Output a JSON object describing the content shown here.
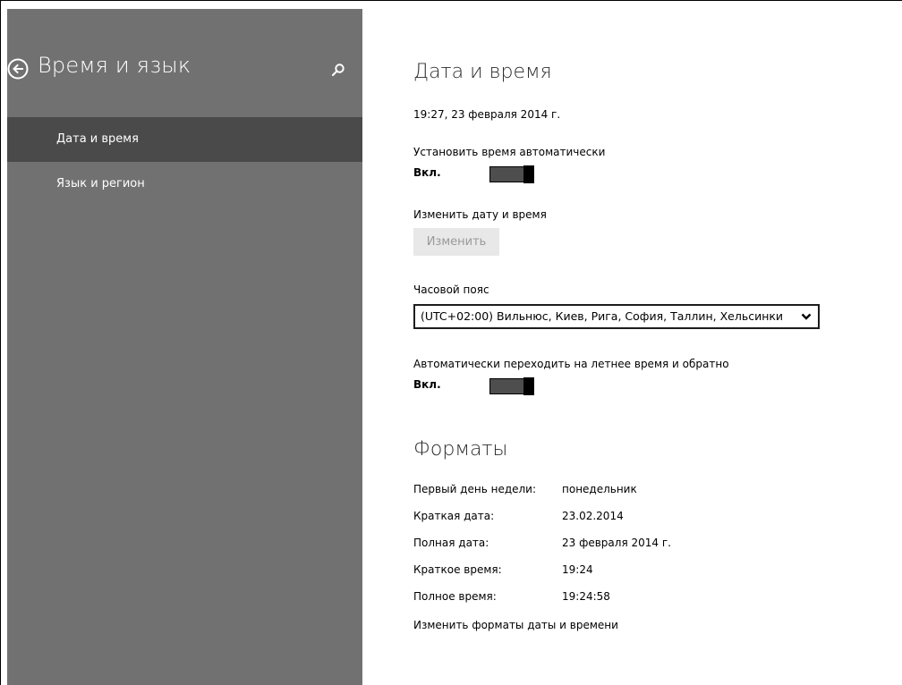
{
  "sidebar": {
    "title": "Время и язык",
    "back_icon": "back-arrow-circle-icon",
    "search_icon": "search-icon",
    "items": [
      {
        "label": "Дата и время",
        "selected": true
      },
      {
        "label": "Язык и регион",
        "selected": false
      }
    ],
    "bg_color": "#717171",
    "selected_color": "#4a4a4a"
  },
  "date_time": {
    "title": "Дата и время",
    "current": "19:27, 23 февраля 2014 г.",
    "auto_time": {
      "label": "Установить время автоматически",
      "state": "Вкл.",
      "on": true
    },
    "change": {
      "label": "Изменить дату и время",
      "button": "Изменить",
      "enabled": false
    },
    "timezone": {
      "label": "Часовой пояс",
      "value": "(UTC+02:00) Вильнюс, Киев, Рига, София, Таллин, Хельсинки"
    },
    "dst": {
      "label": "Автоматически переходить на летнее время и обратно",
      "state": "Вкл.",
      "on": true
    }
  },
  "formats": {
    "title": "Форматы",
    "rows": [
      {
        "key": "Первый день недели:",
        "value": "понедельник"
      },
      {
        "key": "Краткая дата:",
        "value": "23.02.2014"
      },
      {
        "key": "Полная дата:",
        "value": "23 февраля 2014 г."
      },
      {
        "key": "Краткое время:",
        "value": "19:24"
      },
      {
        "key": "Полное время:",
        "value": "19:24:58"
      }
    ],
    "link": "Изменить форматы даты и времени"
  }
}
